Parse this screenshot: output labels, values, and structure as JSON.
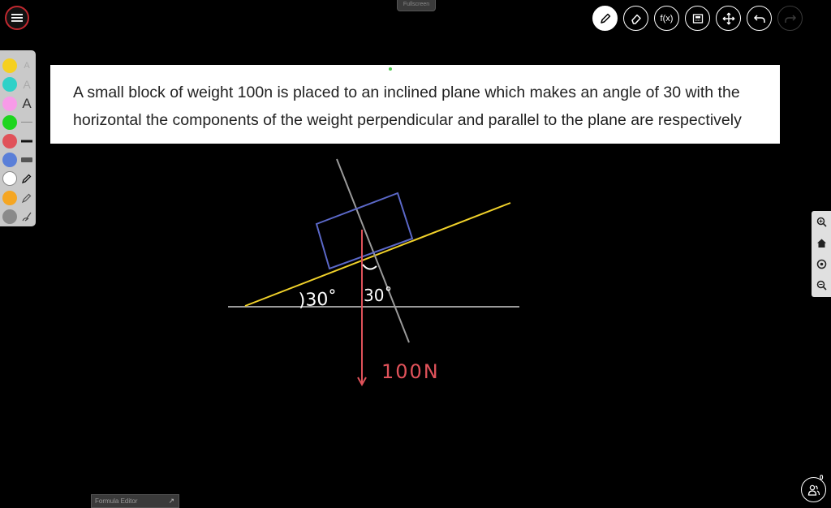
{
  "fullscreen_label": "Fullscreen",
  "question": {
    "line1": "A small block of weight 100n is placed to an inclined plane which makes an angle of 30 with the",
    "line2": "horizontal the components of the weight perpendicular and parallel to the plane are respectively"
  },
  "toolbar": {
    "formula_label": "f(x)",
    "items": [
      "pencil-icon",
      "eraser-icon",
      "formula-icon",
      "media-icon",
      "move-icon",
      "undo-icon",
      "redo-icon"
    ]
  },
  "palette": {
    "colors": [
      "#f5d020",
      "#2fd1c8",
      "#f79be8",
      "#1ed51e",
      "#e0525a",
      "#5a7fd8",
      "#ffffff",
      "#f5a623",
      "#8a8a8a"
    ],
    "text_glyph": "A"
  },
  "drawing": {
    "angle_label_left": ")30˚",
    "angle_label_right": "30˚",
    "weight_label": "100N",
    "colors": {
      "incline": "#f0d12a",
      "ground": "#9a9a9a",
      "block": "#5b68c8",
      "normal_line": "#9a9a9a",
      "weight_arrow": "#e0525a",
      "angle_labels": "#ffffff"
    }
  },
  "zoom_panel": [
    "zoom-in-icon",
    "home-icon",
    "target-icon",
    "zoom-out-icon"
  ],
  "formula_editor": {
    "label": "Formula Editor",
    "arrow": "↗"
  },
  "participants": {
    "count": "0"
  }
}
